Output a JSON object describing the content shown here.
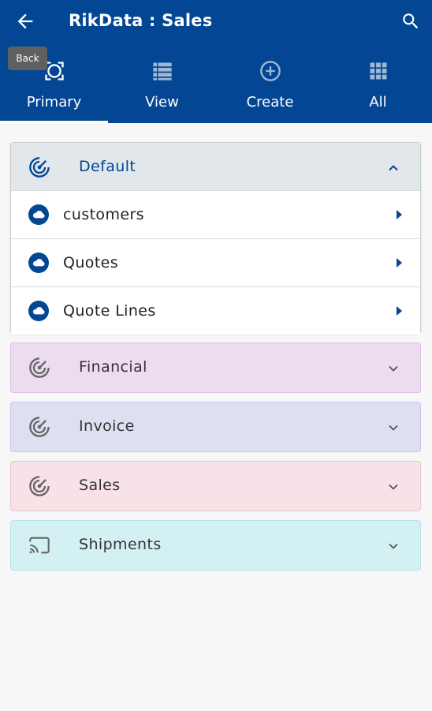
{
  "app": {
    "title": "RikData : Sales",
    "back_tooltip": "Back",
    "colors": {
      "appbar": "#034694",
      "default_header": "#e1e7ea",
      "financial": "#eddcf0",
      "invoice": "#dee0f2",
      "sales": "#f8e2e7",
      "shipments": "#d3f0f2"
    }
  },
  "tabs": [
    {
      "label": "Primary",
      "icon": "target-icon",
      "active": true
    },
    {
      "label": "View",
      "icon": "list-view-icon",
      "active": false
    },
    {
      "label": "Create",
      "icon": "plus-circle-icon",
      "active": false
    },
    {
      "label": "All",
      "icon": "grid-apps-icon",
      "active": false
    }
  ],
  "panels": {
    "default": {
      "title": "Default",
      "icon": "radar-icon",
      "expanded": true,
      "items": [
        {
          "label": "customers",
          "icon": "cloud-icon"
        },
        {
          "label": "Quotes",
          "icon": "cloud-icon"
        },
        {
          "label": "Quote Lines",
          "icon": "cloud-icon"
        }
      ]
    },
    "financial": {
      "title": "Financial",
      "icon": "radar-icon",
      "expanded": false
    },
    "invoice": {
      "title": "Invoice",
      "icon": "radar-icon",
      "expanded": false
    },
    "sales": {
      "title": "Sales",
      "icon": "radar-icon",
      "expanded": false
    },
    "shipments": {
      "title": "Shipments",
      "icon": "cast-icon",
      "expanded": false
    }
  }
}
